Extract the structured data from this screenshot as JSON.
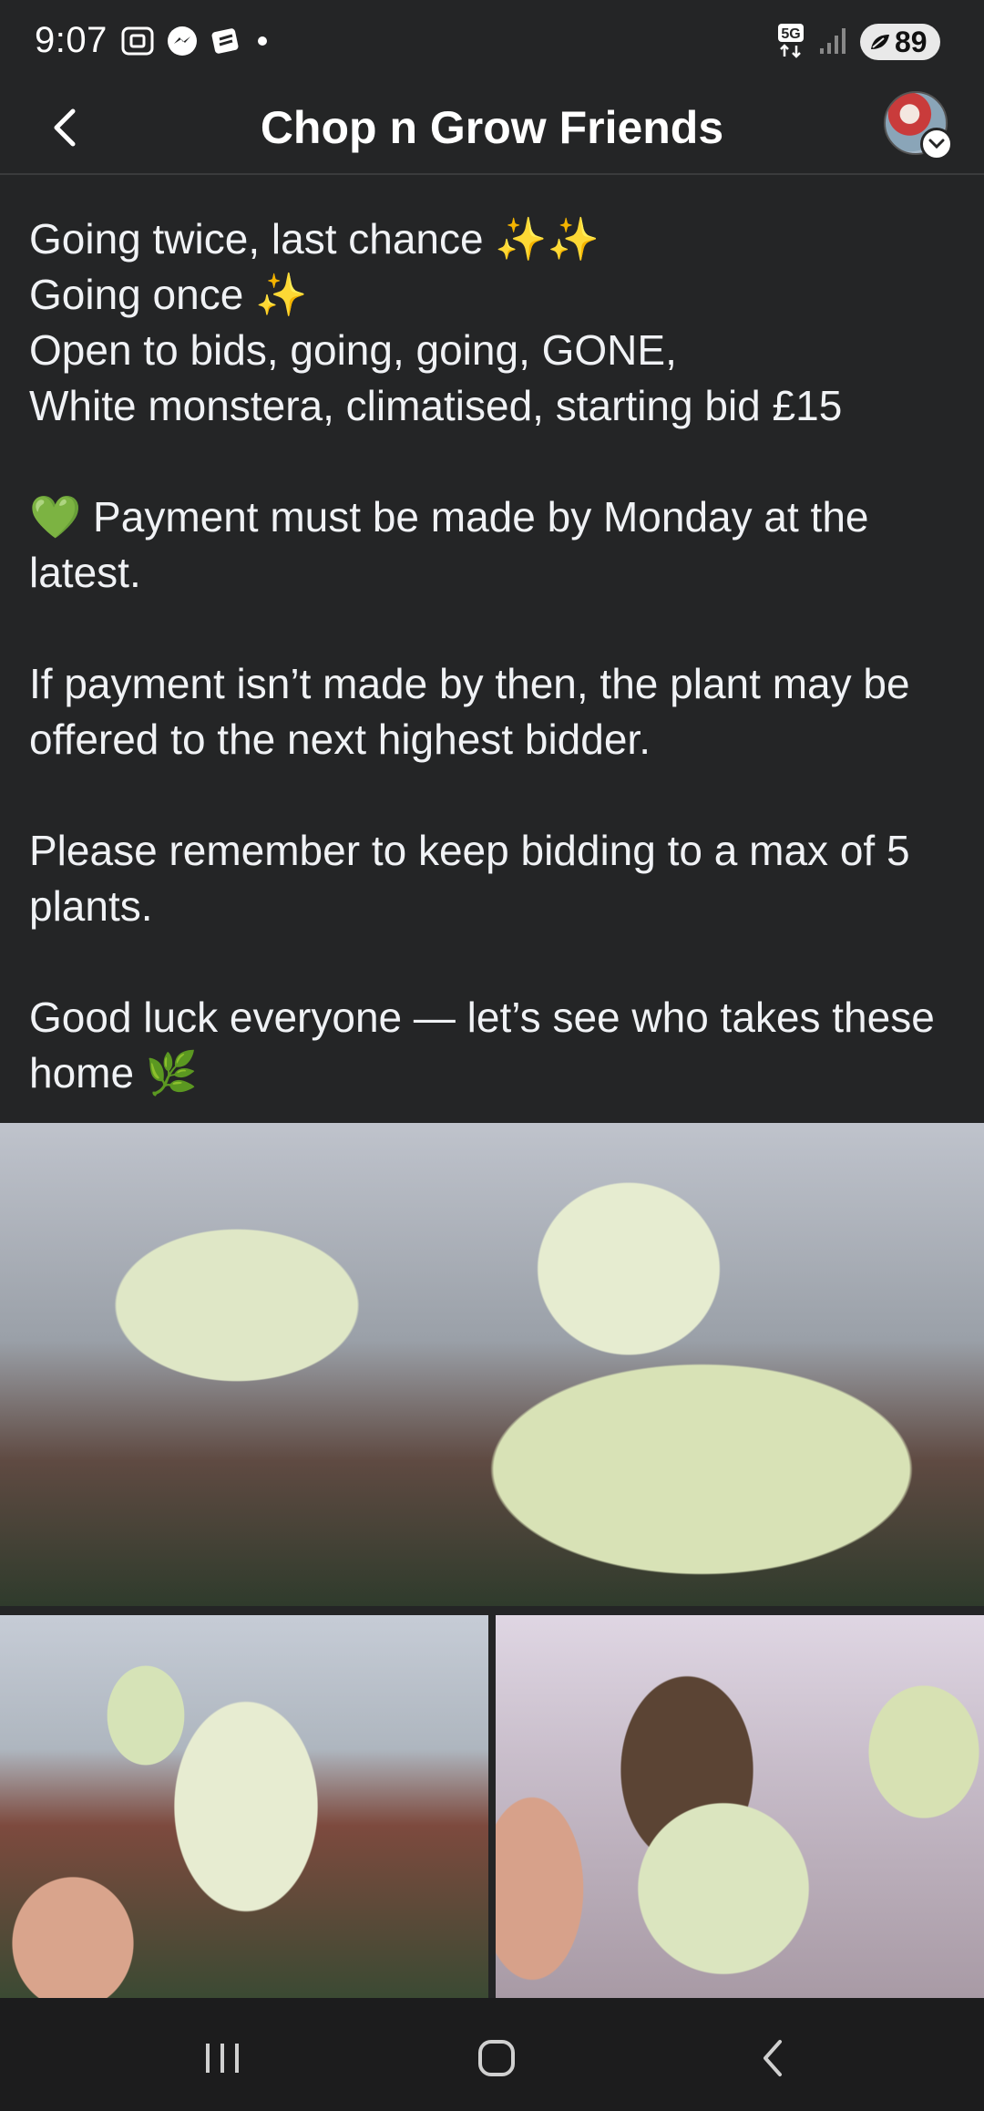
{
  "status_bar": {
    "time": "9:07",
    "battery": "89",
    "network": "5G",
    "icons_left": [
      "screenshot-icon",
      "messenger-icon",
      "stack-icon",
      "dot-icon"
    ],
    "icons_right": [
      "network-5g-icon",
      "signal-icon",
      "battery-icon"
    ]
  },
  "header": {
    "title": "Chop n Grow Friends",
    "back_icon": "back-arrow-icon",
    "profile_icon": "avatar"
  },
  "post": {
    "lines": [
      "Going twice, last chance ✨✨",
      "Going once ✨",
      "Open to bids, going, going, GONE,",
      "White monstera, climatised, starting bid £15"
    ],
    "payment": "💚 Payment must be made by Monday at the latest.",
    "nonpayment": "If payment isn’t made by then, the plant may be offered to the next highest bidder.",
    "limit": "Please remember to keep bidding to a max of 5 plants.",
    "good_luck": "Good luck everyone — let’s see who takes these home 🌿"
  },
  "photos": {
    "main": "monstera-photo-main",
    "bottom_left": "monstera-photo-left",
    "bottom_right": "monstera-photo-right"
  },
  "nav_bar": {
    "recents": "recents-icon",
    "home": "home-icon",
    "back": "back-icon"
  },
  "colors": {
    "background": "#242526",
    "text": "#f0f2f5",
    "divider": "#3a3b3c",
    "nav_bar": "#1c1c1d"
  }
}
